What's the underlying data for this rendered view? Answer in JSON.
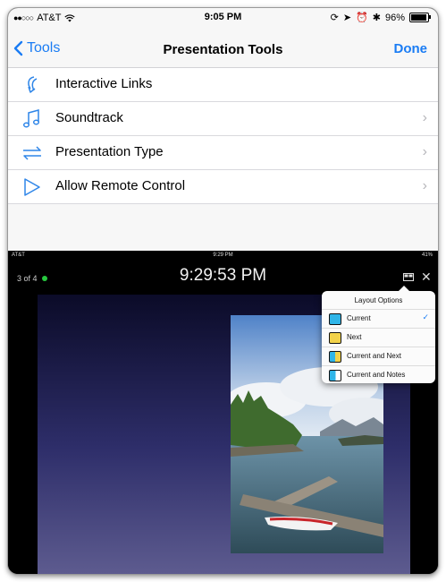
{
  "status_bar": {
    "carrier": "AT&T",
    "time": "9:05 PM",
    "battery": "96%"
  },
  "nav": {
    "back_label": "Tools",
    "title": "Presentation Tools",
    "done_label": "Done"
  },
  "menu": {
    "items": [
      {
        "label": "Interactive Links",
        "icon": "interactive-links-icon",
        "has_chevron": false
      },
      {
        "label": "Soundtrack",
        "icon": "music-note-icon",
        "has_chevron": true
      },
      {
        "label": "Presentation Type",
        "icon": "swap-arrows-icon",
        "has_chevron": true
      },
      {
        "label": "Allow Remote Control",
        "icon": "play-icon",
        "has_chevron": true
      }
    ]
  },
  "presenter": {
    "status_bar": {
      "carrier": "AT&T",
      "time": "9:29 PM",
      "battery": "41%"
    },
    "slide_count": "3 of 4",
    "clock": "9:29:53 PM",
    "layout_options": {
      "title": "Layout Options",
      "selected": "Current",
      "options": [
        "Current",
        "Next",
        "Current and Next",
        "Current and Notes"
      ]
    }
  },
  "colors": {
    "accent": "#1a7cf4",
    "live_dot": "#27c93f",
    "current_swatch": "#2fb5e8",
    "next_swatch": "#f2d24a"
  }
}
